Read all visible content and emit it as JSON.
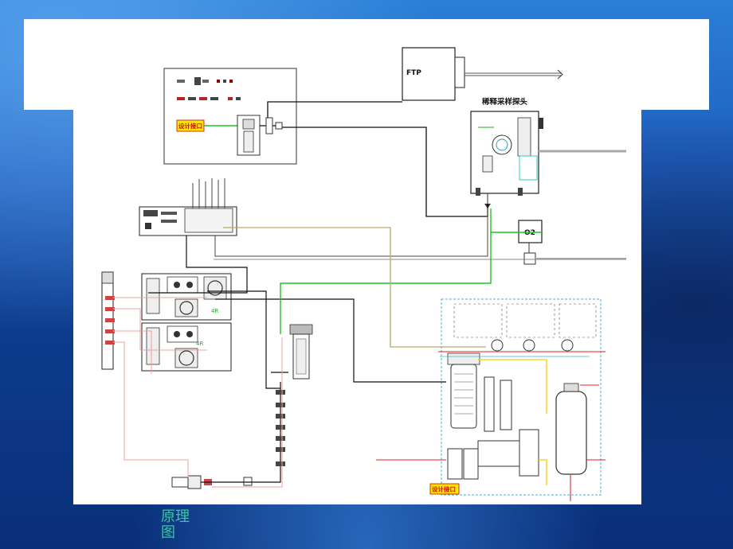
{
  "labels": {
    "ftp": "FTP",
    "probe_title": "稀释采样探头",
    "o2": "O2",
    "design_interface_1": "设计接口",
    "design_interface_2": "设计接口",
    "analyzer_1": "4R",
    "analyzer_2": "4R"
  },
  "caption": "原理图",
  "colors": {
    "black_line": "#111111",
    "green_line": "#22c322",
    "olive_line": "#b7a86a",
    "pink_line": "#f0a0a0",
    "red_line": "#e02020",
    "yellow_line": "#f0d000",
    "cyan_border": "#3fb0d0",
    "label_bg": "#ffe800",
    "label_text": "#d01010"
  }
}
